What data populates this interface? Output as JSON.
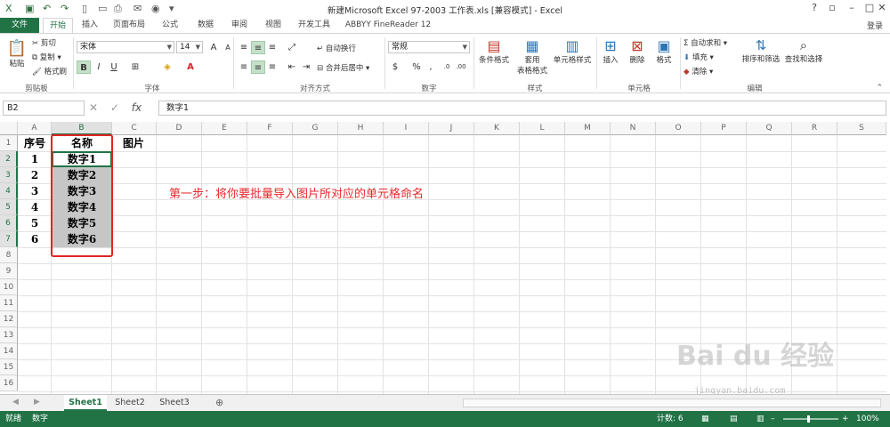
{
  "app": {
    "title": "新建Microsoft Excel 97-2003 工作表.xls  [兼容模式] - Excel",
    "login": "登录",
    "accent": "#217346"
  },
  "tabs": [
    "文件",
    "开始",
    "插入",
    "页面布局",
    "公式",
    "数据",
    "审阅",
    "视图",
    "开发工具",
    "ABBYY FineReader 12"
  ],
  "ribbon": {
    "clipboard": {
      "paste": "粘贴",
      "cut": "剪切",
      "copy": "复制",
      "format_painter": "格式刷",
      "label": "剪贴板"
    },
    "font": {
      "name": "宋体",
      "size": "14",
      "label": "字体"
    },
    "alignment": {
      "wrap": "自动换行",
      "merge": "合并后居中",
      "label": "对齐方式"
    },
    "number": {
      "format": "常规",
      "label": "数字"
    },
    "styles": {
      "cond": "条件格式",
      "table_fmt_1": "套用",
      "table_fmt_2": "表格格式",
      "cell_styles": "单元格样式",
      "label": "样式"
    },
    "cells": {
      "insert": "插入",
      "delete": "删除",
      "format": "格式",
      "label": "单元格"
    },
    "editing": {
      "autosum": "自动求和",
      "fill": "填充",
      "clear": "清除",
      "sort": "排序和筛选",
      "find": "查找和选择",
      "label": "编辑"
    }
  },
  "formula_bar": {
    "name_box": "B2",
    "fx": "fx",
    "content": "数字1"
  },
  "columns": [
    "A",
    "B",
    "C",
    "D",
    "E",
    "F",
    "G",
    "H",
    "I",
    "J",
    "K",
    "L",
    "M",
    "N",
    "O",
    "P",
    "Q",
    "R",
    "S"
  ],
  "rows": [
    "1",
    "2",
    "3",
    "4",
    "5",
    "6",
    "7",
    "8",
    "9",
    "10",
    "11",
    "12",
    "13",
    "14",
    "15",
    "16"
  ],
  "sheet_cells": {
    "header": [
      "序号",
      "名称",
      "图片"
    ],
    "data": [
      [
        "1",
        "数字1"
      ],
      [
        "2",
        "数字2"
      ],
      [
        "3",
        "数字3"
      ],
      [
        "4",
        "数字4"
      ],
      [
        "5",
        "数字5"
      ],
      [
        "6",
        "数字6"
      ]
    ]
  },
  "annotation": "第一步：将你要批量导入图片所对应的单元格命名",
  "sheets": [
    "Sheet1",
    "Sheet2",
    "Sheet3"
  ],
  "statusbar": {
    "ready": "就绪",
    "mode": "数字",
    "count": "计数: 6",
    "zoom": "100%"
  },
  "watermark": {
    "brand": "Bai du 经验",
    "url": "jingyan.baidu.com"
  }
}
